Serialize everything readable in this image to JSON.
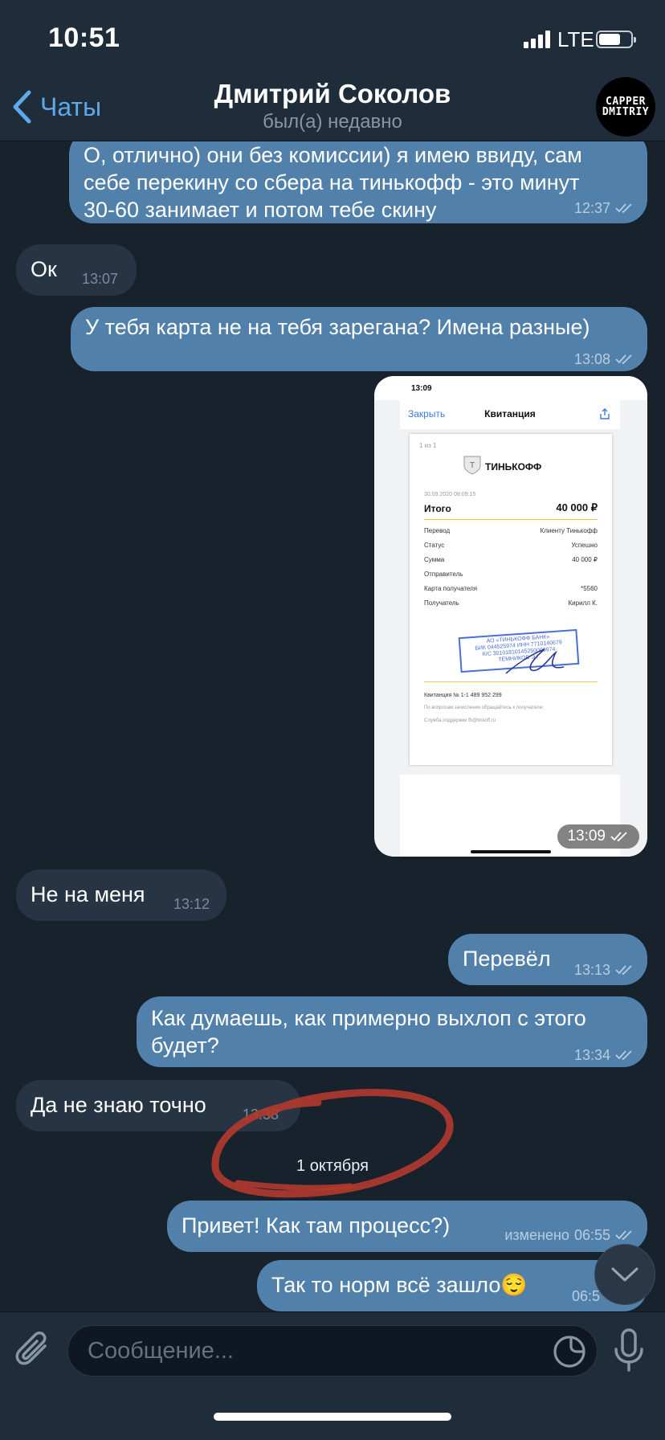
{
  "status_bar": {
    "time": "10:51",
    "network": "LTE"
  },
  "nav": {
    "back_label": "Чаты",
    "title": "Дмитрий Соколов",
    "subtitle": "был(а) недавно",
    "avatar_line1": "CAPPER",
    "avatar_line2": "DMITRIY"
  },
  "messages": [
    {
      "dir": "out",
      "text": "О, отлично) они без комиссии) я имею ввиду, сам\nсебе перекину со сбера на тинькофф - это минут\n30-60 занимает и потом тебе скину",
      "time": "12:37",
      "read": true
    },
    {
      "dir": "in",
      "text": "Ок",
      "time": "13:07"
    },
    {
      "dir": "out",
      "text": "У тебя карта не на тебя зарегана? Имена разные)",
      "time": "13:08",
      "read": true
    },
    {
      "dir": "out",
      "type": "image",
      "time": "13:09",
      "read": true
    },
    {
      "dir": "in",
      "text": "Не на меня",
      "time": "13:12"
    },
    {
      "dir": "out",
      "text": "Перевёл",
      "time": "13:13",
      "read": true
    },
    {
      "dir": "out",
      "text": "Как думаешь, как примерно выхлоп с этого\nбудет?",
      "time": "13:34",
      "read": true
    },
    {
      "dir": "in",
      "text": "Да не знаю точно",
      "time": "13:38"
    },
    {
      "dir": "out",
      "text": "Привет! Как там процесс?)",
      "time": "06:55",
      "edited_label": "изменено",
      "read": true
    },
    {
      "dir": "out",
      "text": "Так то норм всё зашло😌",
      "time": "06:5"
    }
  ],
  "date_separator": "1 октября",
  "receipt": {
    "phone_time": "13:09",
    "close_label": "Закрыть",
    "header": "Квитанция",
    "page": "1 из 1",
    "bank": "ТИНЬКОФФ",
    "datetime": "30.09.2020 08:09:15",
    "total_label": "Итого",
    "total_value": "40 000 ₽",
    "rows": [
      {
        "label": "Перевод",
        "value": "Клиенту Тинькофф"
      },
      {
        "label": "Статус",
        "value": "Успешно"
      },
      {
        "label": "Сумма",
        "value": "40 000 ₽"
      },
      {
        "label": "Отправитель",
        "value": ""
      },
      {
        "label": "Карта получателя",
        "value": "*5560"
      },
      {
        "label": "Получатель",
        "value": "Кирилл К."
      }
    ],
    "stamp_lines": [
      "АО «ТИНЬКОФФ БАНК»",
      "БИК 044525974  ИНН 7710140679",
      "К/С 30101810145250000974",
      "ТЕМНИКОВ Э.Г."
    ],
    "receipt_number": "Квитанция  № 1-1 489 952 299",
    "note": "По вопросам зачисления обращайтесь к получателю",
    "support": "Служба поддержки fb@tinkoff.ru"
  },
  "input": {
    "placeholder": "Сообщение..."
  },
  "colors": {
    "bg": "#18222d",
    "bar": "#1f2c3a",
    "out_bubble": "#5181aa",
    "in_bubble": "#263444",
    "accent": "#5fa8ea",
    "annotation": "#c0392b"
  }
}
